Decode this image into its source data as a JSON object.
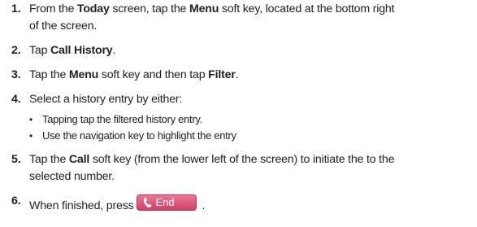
{
  "steps": [
    {
      "num": "1.",
      "parts": [
        "From the ",
        "Today",
        " screen, tap the ",
        "Menu",
        " soft key, located at the bottom right"
      ],
      "line2": "of the screen."
    },
    {
      "num": "2.",
      "parts": [
        "Tap ",
        "Call History",
        "."
      ]
    },
    {
      "num": "3.",
      "parts": [
        "Tap the ",
        "Menu",
        " soft key and then tap ",
        "Filter",
        "."
      ]
    },
    {
      "num": "4.",
      "text": "Select a history entry by either:",
      "bullets": [
        "Tapping tap the filtered history entry.",
        "Use the navigation key to highlight the entry"
      ]
    },
    {
      "num": "5.",
      "parts": [
        "Tap the ",
        "Call",
        " soft key (from the lower left of the screen) to initiate the to the"
      ],
      "line2": "selected number."
    },
    {
      "num": "6.",
      "text": "When finished, press",
      "end_label": "End",
      "trailing": "."
    }
  ],
  "bullet_glyph": "•",
  "colors": {
    "text": "#222222",
    "end_key": "#d9506f",
    "end_key_text": "#ffffff"
  },
  "icons": {
    "end_key_icon": "phone-handset-icon"
  }
}
